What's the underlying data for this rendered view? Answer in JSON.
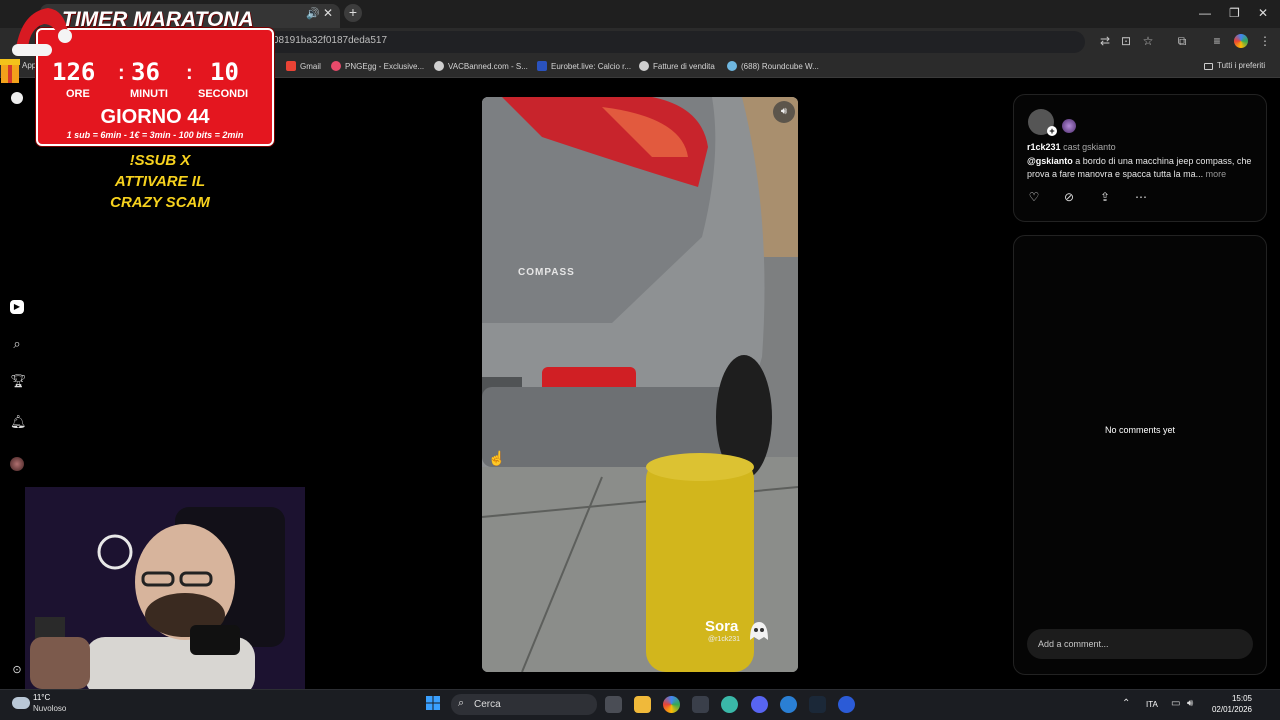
{
  "browser": {
    "url": "08191ba32f0187deda517",
    "tab_audio_icon": "speaker-icon",
    "bookmarks": [
      {
        "label": "Gmail",
        "icon": "gmail-icon"
      },
      {
        "label": "PNGEgg - Exclusive...",
        "icon": "pngegg-icon"
      },
      {
        "label": "VACBanned.com - S...",
        "icon": "globe-icon"
      },
      {
        "label": "Eurobet.live: Calcio r...",
        "icon": "eurobet-icon"
      },
      {
        "label": "Fatture di vendita",
        "icon": "globe-icon"
      },
      {
        "label": "(688) Roundcube W...",
        "icon": "roundcube-icon"
      }
    ],
    "all_bookmarks": "Tutti i preferiti",
    "apps_label": "App"
  },
  "overlay": {
    "title": "TIMER MARATONA",
    "hours": "126",
    "minutes": "36",
    "seconds": "10",
    "hours_label": "ORE",
    "minutes_label": "MINUTI",
    "seconds_label": "SECONDI",
    "day": "GIORNO 44",
    "rates": "1 sub = 6min - 1€ = 3min - 100 bits = 2min",
    "promo_line1": "!SSUB X",
    "promo_line2": "ATTIVARE IL",
    "promo_line3": "CRAZY SCAM",
    "accent": "#e4161f",
    "promo_color": "#f7d21e"
  },
  "video": {
    "car_badge": "COMPASS",
    "watermark": "Sora",
    "watermark_handle": "@r1ck231"
  },
  "post": {
    "author": "r1ck231",
    "cast_text": "cast gskianto",
    "mention": "@gskianto",
    "caption": " a bordo di una macchina jeep compass, che prova a fare manovra e spacca tutta la ma...",
    "more": "more",
    "actions": [
      "heart-icon",
      "remix-icon",
      "share-icon",
      "more-icon"
    ]
  },
  "comments": {
    "empty": "No comments yet",
    "placeholder": "Add a comment..."
  },
  "taskbar": {
    "temperature": "11°C",
    "condition": "Nuvoloso",
    "search": "Cerca",
    "language": "ITA",
    "time": "15:05",
    "date": "02/01/2026"
  }
}
